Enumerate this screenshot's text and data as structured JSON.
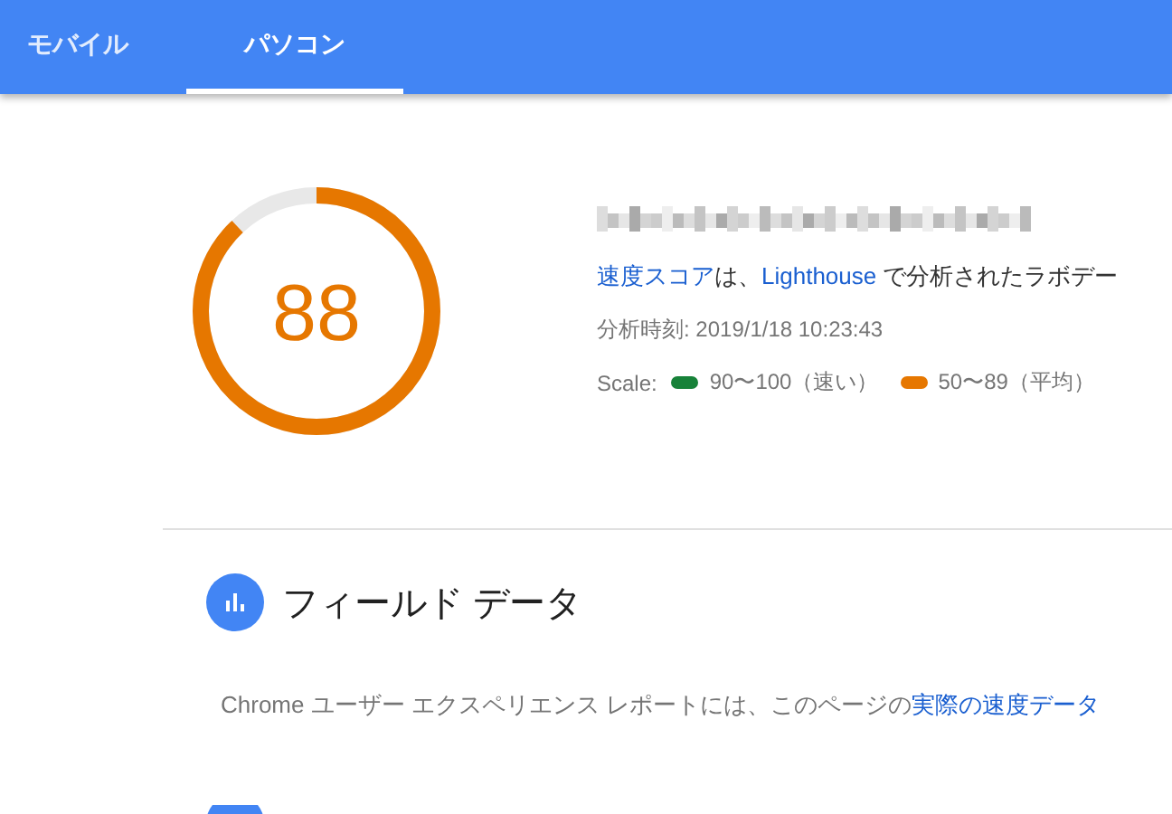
{
  "tabs": [
    {
      "label": "モバイル",
      "selected": false
    },
    {
      "label": "パソコン",
      "selected": true
    }
  ],
  "summary": {
    "score": "88",
    "color": "#e67700",
    "description": [
      {
        "text": "速度スコア",
        "link": true
      },
      {
        "text": "は、",
        "link": false
      },
      {
        "text": "Lighthouse",
        "link": true
      },
      {
        "text": " で分析されたラボデー",
        "link": false
      }
    ],
    "analysis_time": "分析時刻: 2019/1/18 10:23:43",
    "scale_label": "Scale:",
    "scale": [
      {
        "label": "90〜100（速い）",
        "color": "#178239"
      },
      {
        "label": "50〜89（平均）",
        "color": "#e67700"
      }
    ]
  },
  "field_data": {
    "heading": "フィールド データ",
    "text": [
      {
        "text": "Chrome ユーザー エクスペリエンス レポートには、このページの",
        "link": false
      },
      {
        "text": "実際の速度データ",
        "link": true
      }
    ]
  }
}
